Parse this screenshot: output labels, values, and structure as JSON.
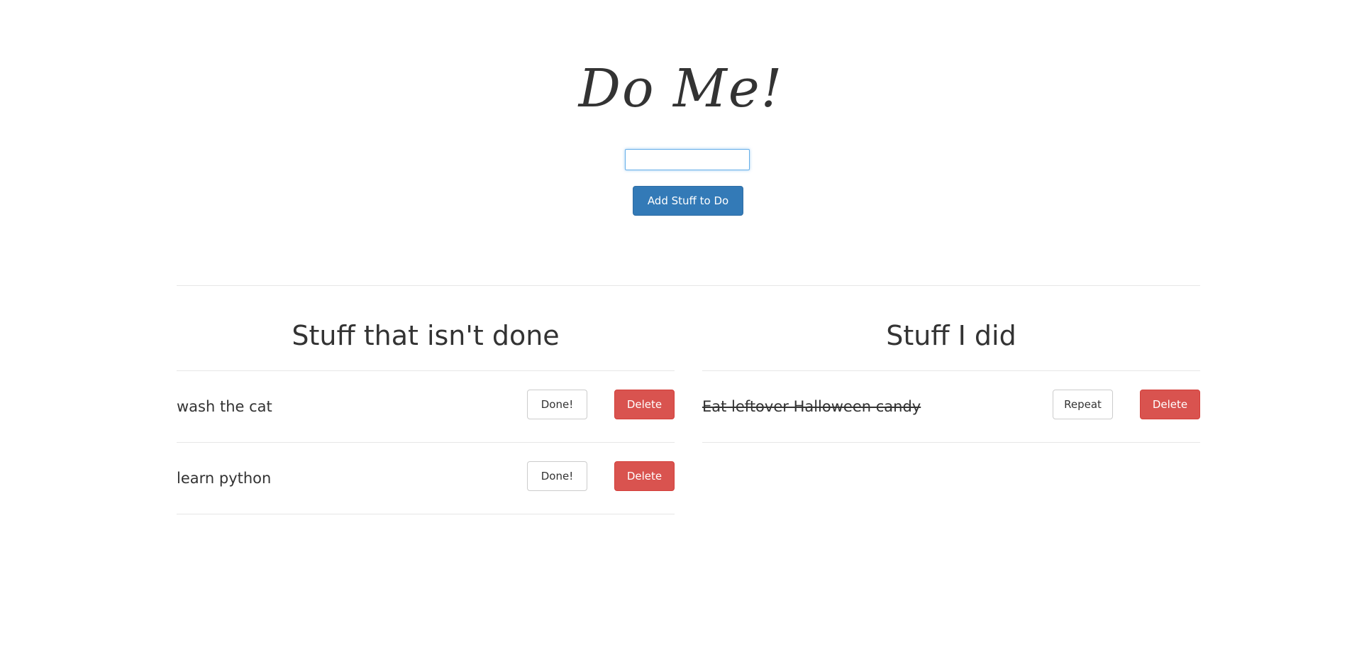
{
  "header": {
    "title": "Do Me!",
    "input_value": "",
    "add_label": "Add Stuff to Do"
  },
  "todo": {
    "heading": "Stuff that isn't done",
    "items": [
      {
        "text": "wash the cat",
        "done_label": "Done!",
        "delete_label": "Delete"
      },
      {
        "text": "learn python",
        "done_label": "Done!",
        "delete_label": "Delete"
      }
    ]
  },
  "done": {
    "heading": "Stuff I did",
    "items": [
      {
        "text": "Eat leftover Halloween candy",
        "repeat_label": "Repeat",
        "delete_label": "Delete"
      }
    ]
  },
  "colors": {
    "primary": "#337ab7",
    "danger": "#d9534f",
    "focus_border": "#66afe9",
    "divider": "#e6e6e6"
  }
}
